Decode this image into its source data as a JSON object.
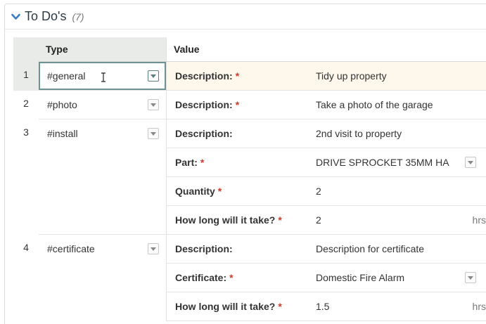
{
  "panel": {
    "title": "To Do's",
    "count": "(7)"
  },
  "columns": {
    "type": "Type",
    "value": "Value"
  },
  "rows": [
    {
      "num": "1",
      "type": "#general",
      "fields": [
        {
          "label": "Description:",
          "required": true,
          "value": "Tidy up property"
        }
      ]
    },
    {
      "num": "2",
      "type": "#photo",
      "fields": [
        {
          "label": "Description:",
          "required": true,
          "value": "Take a photo of the garage"
        }
      ]
    },
    {
      "num": "3",
      "type": "#install",
      "fields": [
        {
          "label": "Description:",
          "required": false,
          "value": "2nd visit to property"
        },
        {
          "label": "Part:",
          "required": true,
          "value": "DRIVE SPROCKET 35MM HA"
        },
        {
          "label": "Quantity",
          "required": true,
          "value": "2"
        },
        {
          "label": "How long will it take?",
          "required": true,
          "value": "2",
          "unit": "hrs"
        }
      ]
    },
    {
      "num": "4",
      "type": "#certificate",
      "fields": [
        {
          "label": "Description:",
          "required": false,
          "value": "Description for certificate"
        },
        {
          "label": "Certificate:",
          "required": true,
          "value": "Domestic Fire Alarm"
        },
        {
          "label": "How long will it take?",
          "required": true,
          "value": "1.5",
          "unit": "hrs"
        }
      ]
    }
  ],
  "required_marker": "*",
  "icons": {
    "collapse": "chevron-down-icon",
    "dropdown": "dropdown-caret-icon",
    "text_cursor": "text-cursor-icon"
  },
  "colors": {
    "accent": "#3b7bbf",
    "required": "#d0392b",
    "active_row": "#fdf7ec",
    "focus_border": "#6e9393"
  }
}
